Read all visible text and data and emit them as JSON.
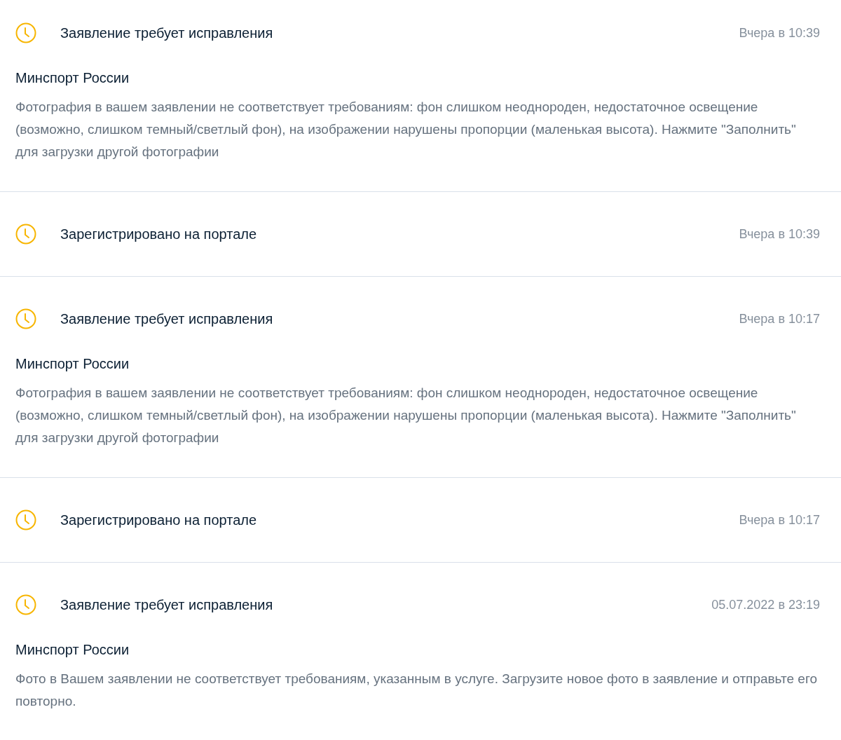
{
  "events": [
    {
      "title": "Заявление требует исправления",
      "time": "Вчера в 10:39",
      "organization": "Минспорт России",
      "message": "Фотография в вашем заявлении не соответствует требованиям: фон слишком неоднороден, недостаточное освещение (возможно, слишком темный/светлый фон), на изображении нарушены пропорции (маленькая высота). Нажмите \"Заполнить\" для загрузки другой фотографии"
    },
    {
      "title": "Зарегистрировано на портале",
      "time": "Вчера в 10:39"
    },
    {
      "title": "Заявление требует исправления",
      "time": "Вчера в 10:17",
      "organization": "Минспорт России",
      "message": "Фотография в вашем заявлении не соответствует требованиям: фон слишком неоднороден, недостаточное освещение (возможно, слишком темный/светлый фон), на изображении нарушены пропорции (маленькая высота). Нажмите \"Заполнить\" для загрузки другой фотографии"
    },
    {
      "title": "Зарегистрировано на портале",
      "time": "Вчера в 10:17"
    },
    {
      "title": "Заявление требует исправления",
      "time": "05.07.2022 в 23:19",
      "organization": "Минспорт России",
      "message": "Фото в Вашем заявлении не соответствует требованиям, указанным в услуге. Загрузите новое фото в заявление и отправьте его повторно."
    }
  ]
}
